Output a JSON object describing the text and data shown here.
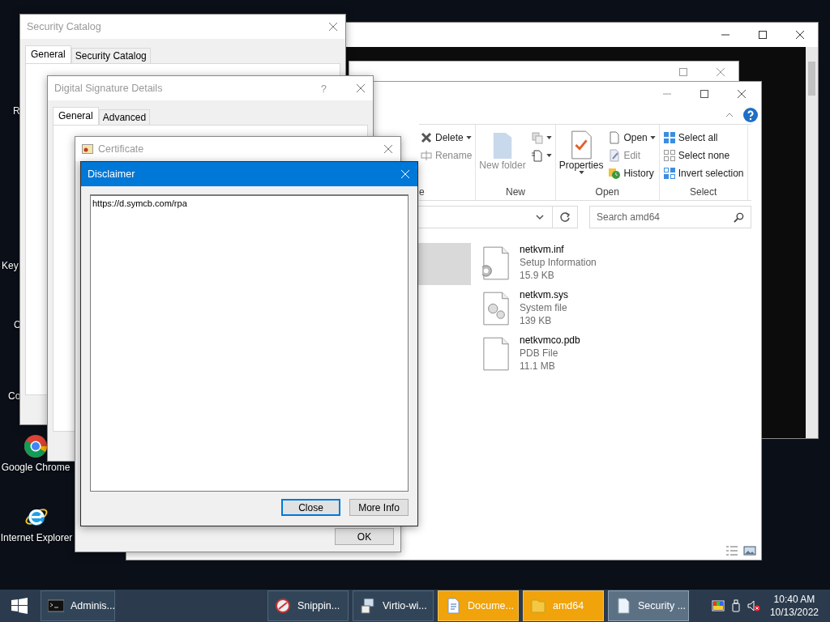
{
  "desktop_icons": [
    {
      "label": "R",
      "kind": "none"
    },
    {
      "label": "Key",
      "kind": "none"
    },
    {
      "label": "C",
      "kind": "none"
    },
    {
      "label": "Co",
      "kind": "none"
    },
    {
      "label": "Google Chrome",
      "kind": "chrome"
    },
    {
      "label": "Internet Explorer",
      "kind": "ie"
    }
  ],
  "explorer": {
    "ribbon": [
      {
        "label": "e",
        "items": [
          {
            "kind": "small",
            "label": "Delete",
            "dropdown": true,
            "disabled": false
          },
          {
            "kind": "small",
            "label": "Rename",
            "dropdown": false,
            "disabled": true
          }
        ]
      },
      {
        "label": "New",
        "items": [
          {
            "kind": "large",
            "label": "New folder",
            "dropdown": false,
            "disabled": true
          },
          {
            "kind": "icon",
            "dropdown": true,
            "disabled": true
          },
          {
            "kind": "icon",
            "dropdown": true,
            "disabled": false
          }
        ]
      },
      {
        "label": "Open",
        "items": [
          {
            "kind": "large",
            "label": "Properties",
            "dropdown": true,
            "disabled": false
          },
          {
            "kind": "small",
            "label": "Open",
            "dropdown": true,
            "disabled": false
          },
          {
            "kind": "small",
            "label": "Edit",
            "dropdown": false,
            "disabled": true
          },
          {
            "kind": "small",
            "label": "History",
            "dropdown": false,
            "disabled": false
          }
        ]
      },
      {
        "label": "Select",
        "items": [
          {
            "kind": "small",
            "label": "Select all",
            "dropdown": false,
            "disabled": false
          },
          {
            "kind": "small",
            "label": "Select none",
            "dropdown": false,
            "disabled": false
          },
          {
            "kind": "small",
            "label": "Invert selection",
            "dropdown": false,
            "disabled": false
          }
        ]
      }
    ],
    "search": {
      "placeholder": "Search amd64"
    },
    "files": [
      {
        "name": "netkvm.inf",
        "type": "Setup Information",
        "size": "15.9 KB",
        "kind": "setup"
      },
      {
        "name": "netkvm.sys",
        "type": "System file",
        "size": "139 KB",
        "kind": "system"
      },
      {
        "name": "netkvmco.pdb",
        "type": "PDB File",
        "size": "11.1 MB",
        "kind": "plain"
      }
    ]
  },
  "security_catalog": {
    "title": "Security Catalog",
    "active": false,
    "tabs": [
      {
        "label": "General",
        "selected": true
      },
      {
        "label": "Security Catalog",
        "selected": false
      }
    ]
  },
  "signature_details": {
    "title": "Digital Signature Details",
    "active": false,
    "help": "?",
    "tabs": [
      {
        "label": "General",
        "selected": true
      },
      {
        "label": "Advanced",
        "selected": false
      }
    ]
  },
  "certificate": {
    "title": "Certificate",
    "active": false,
    "button": "OK"
  },
  "disclaimer": {
    "title": "Disclaimer",
    "active": true,
    "text": "https://d.symcb.com/rpa",
    "buttons": [
      {
        "label": "Close",
        "default": true
      },
      {
        "label": "More Info",
        "default": false
      }
    ]
  },
  "taskbar": {
    "items": [
      {
        "label": "Adminis...",
        "selected": false,
        "flashing": false
      },
      {
        "label": "Snippin...",
        "selected": false,
        "flashing": false
      },
      {
        "label": "Virtio-wi...",
        "selected": false,
        "flashing": false
      },
      {
        "label": "Docume...",
        "selected": false,
        "flashing": true
      },
      {
        "label": "amd64",
        "selected": false,
        "flashing": true
      },
      {
        "label": "Security ...",
        "selected": true,
        "flashing": false
      }
    ],
    "time": "10:40 AM",
    "date": "10/13/2022"
  }
}
